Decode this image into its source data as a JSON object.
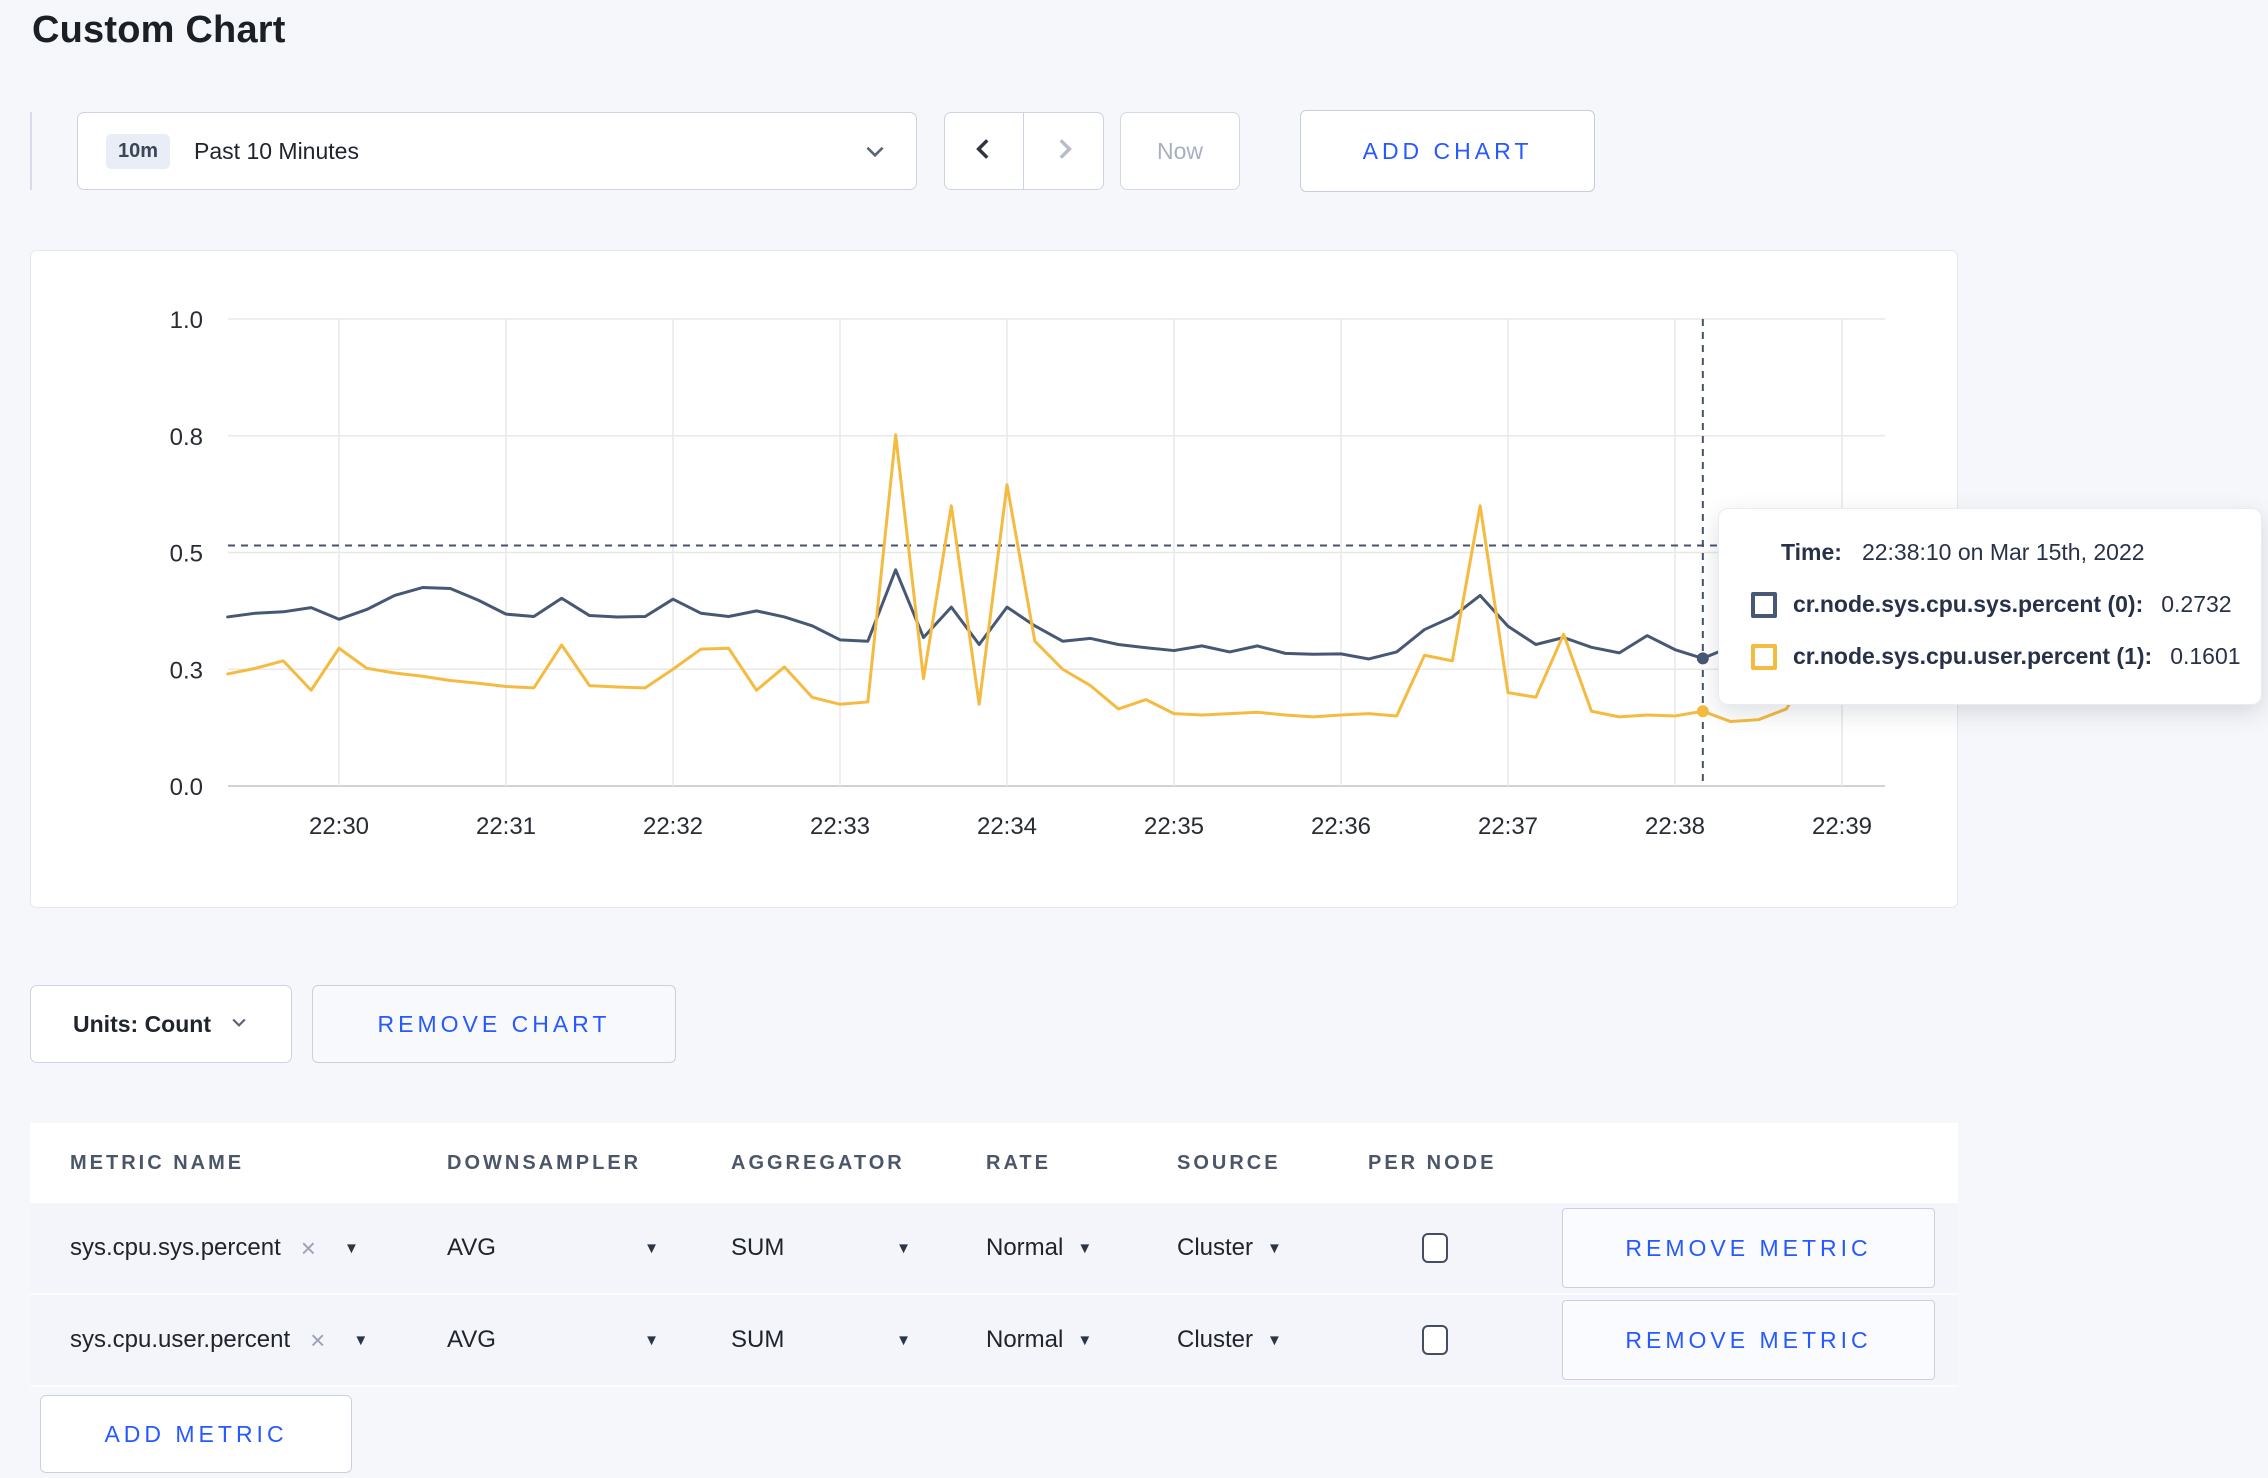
{
  "page": {
    "title": "Custom Chart"
  },
  "toolbar": {
    "time_badge": "10m",
    "time_label": "Past 10 Minutes",
    "now_label": "Now",
    "add_chart_label": "ADD CHART"
  },
  "chart_data": {
    "type": "line",
    "title": "",
    "xlabel": "",
    "ylabel": "",
    "ylim": [
      0,
      1
    ],
    "grid": true,
    "y_tick_labels": [
      "0.0",
      "0.3",
      "0.5",
      "0.8",
      "1.0"
    ],
    "y_tick_positions": [
      0,
      0.25,
      0.5,
      0.75,
      1.0
    ],
    "x_ticks": [
      "22:30",
      "22:31",
      "22:32",
      "22:33",
      "22:34",
      "22:35",
      "22:36",
      "22:37",
      "22:38",
      "22:39"
    ],
    "x_start_offset_seconds": -40,
    "x_step_seconds": 10,
    "crosshair": {
      "time": "22:38:10",
      "y_fraction": 0.515
    },
    "series": [
      {
        "name": "cr.node.sys.cpu.sys.percent (0)",
        "color": "#475874",
        "values": [
          0.362,
          0.37,
          0.373,
          0.382,
          0.357,
          0.378,
          0.408,
          0.425,
          0.423,
          0.398,
          0.368,
          0.363,
          0.402,
          0.365,
          0.362,
          0.363,
          0.4,
          0.37,
          0.363,
          0.375,
          0.362,
          0.343,
          0.313,
          0.31,
          0.463,
          0.318,
          0.383,
          0.303,
          0.383,
          0.343,
          0.31,
          0.316,
          0.303,
          0.296,
          0.29,
          0.3,
          0.287,
          0.3,
          0.284,
          0.282,
          0.283,
          0.272,
          0.287,
          0.335,
          0.362,
          0.408,
          0.342,
          0.303,
          0.318,
          0.297,
          0.285,
          0.322,
          0.292,
          0.2732,
          0.298,
          0.303,
          0.308,
          0.303,
          0.3,
          0.304,
          0.3
        ]
      },
      {
        "name": "cr.node.sys.cpu.user.percent (1)",
        "color": "#f5bb41",
        "values": [
          0.24,
          0.252,
          0.268,
          0.205,
          0.295,
          0.252,
          0.242,
          0.235,
          0.226,
          0.22,
          0.213,
          0.21,
          0.302,
          0.215,
          0.212,
          0.21,
          0.25,
          0.293,
          0.295,
          0.205,
          0.255,
          0.19,
          0.175,
          0.18,
          0.752,
          0.23,
          0.6,
          0.175,
          0.645,
          0.31,
          0.25,
          0.215,
          0.165,
          0.185,
          0.155,
          0.152,
          0.155,
          0.158,
          0.152,
          0.148,
          0.152,
          0.155,
          0.15,
          0.28,
          0.268,
          0.6,
          0.2,
          0.19,
          0.325,
          0.16,
          0.148,
          0.152,
          0.15,
          0.1601,
          0.138,
          0.142,
          0.165,
          0.255,
          0.235,
          0.285,
          0.25
        ]
      }
    ]
  },
  "tooltip": {
    "time_label": "Time:",
    "time_value": "22:38:10 on Mar 15th, 2022",
    "series": [
      {
        "name": "cr.node.sys.cpu.sys.percent (0):",
        "value": "0.2732"
      },
      {
        "name": "cr.node.sys.cpu.user.percent (1):",
        "value": "0.1601"
      }
    ]
  },
  "units_bar": {
    "units_label": "Units: Count",
    "remove_chart_label": "REMOVE CHART"
  },
  "metrics_table": {
    "headers": [
      "METRIC NAME",
      "DOWNSAMPLER",
      "AGGREGATOR",
      "RATE",
      "SOURCE",
      "PER NODE"
    ],
    "rows": [
      {
        "metric": "sys.cpu.sys.percent",
        "downsampler": "AVG",
        "aggregator": "SUM",
        "rate": "Normal",
        "source": "Cluster",
        "per_node_checked": false,
        "remove_label": "REMOVE METRIC"
      },
      {
        "metric": "sys.cpu.user.percent",
        "downsampler": "AVG",
        "aggregator": "SUM",
        "rate": "Normal",
        "source": "Cluster",
        "per_node_checked": false,
        "remove_label": "REMOVE METRIC"
      }
    ],
    "add_metric_label": "ADD METRIC"
  },
  "colors": {
    "accent_blue": "#2659ff",
    "series_sys": "#475874",
    "series_user": "#f5bb41",
    "crosshair": "#47536d"
  }
}
